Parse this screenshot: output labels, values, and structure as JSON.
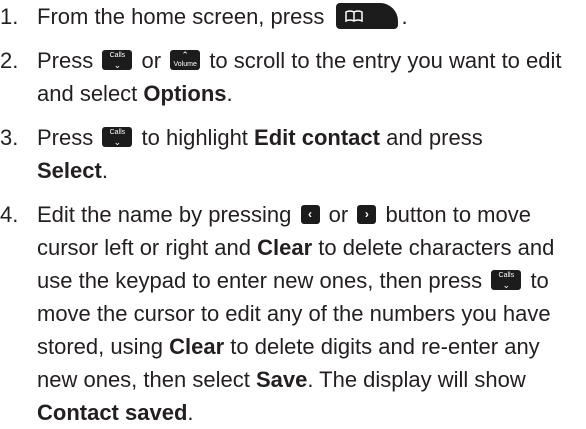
{
  "steps": [
    {
      "number": "1.",
      "parts": {
        "a": "From the home screen, press",
        "b": "."
      },
      "home_key_icon": "book-icon"
    },
    {
      "number": "2.",
      "parts": {
        "a": "Press",
        "b": "or",
        "c": "to scroll to the entry you want to edit and select",
        "d": "Options",
        "e": "."
      },
      "keys": {
        "calls": "Calls",
        "volume": "Volume"
      }
    },
    {
      "number": "3.",
      "parts": {
        "a": "Press",
        "b": "to highlight",
        "c": "Edit contact",
        "d": "and press",
        "e": "Select",
        "f": "."
      },
      "keys": {
        "calls": "Calls"
      }
    },
    {
      "number": "4.",
      "parts": {
        "a": "Edit the name by pressing",
        "b": "or",
        "c": "button to move cursor left or right and",
        "d": "Clear",
        "e": "to delete characters and use the keypad to enter new ones, then press",
        "f": "to move the cursor to edit any of the numbers you have stored, using",
        "g": "Clear",
        "h": "to delete digits and re-enter any new ones, then select",
        "i": "Save",
        "j": ". The display will show",
        "k": "Contact saved",
        "l": "."
      },
      "keys": {
        "left": "‹",
        "right": "›",
        "calls": "Calls"
      }
    }
  ]
}
